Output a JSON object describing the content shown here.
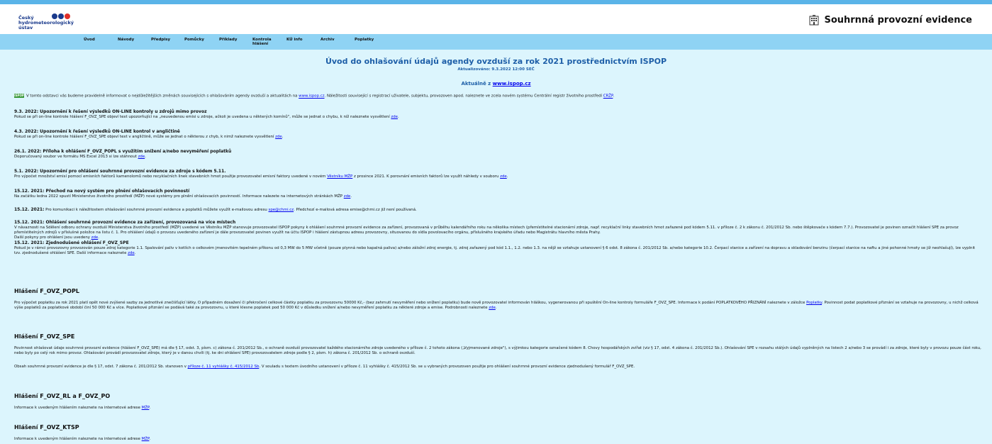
{
  "header": {
    "logo_lines": [
      "Český",
      "hydrometeorologický",
      "ústav"
    ],
    "title": "Souhrnná provozní evidence",
    "icon": "office-building-icon"
  },
  "nav": [
    "Úvod",
    "Návody",
    "Předpisy",
    "Pomůcky",
    "Příklady",
    "Kontrola hlášení",
    "KÚ info",
    "Archiv",
    "Poplatky"
  ],
  "main": {
    "title": "Úvod do ohlašování údajů agendy ovzduší za rok 2021 prostřednictvím ISPOP",
    "updated": "Aktualizováno: 9.3.2022 12:00 SEČ",
    "latest_prefix": "Aktuálně z ",
    "latest_link": "www.ispop.cz"
  },
  "intro": {
    "badge": "ISPOP",
    "text1": "V tomto odstavci vás budeme pravidelně informovat o nejdůležitějších změnách souvisejících s ohlašováním agendy ovzduší a aktualitách na ",
    "link1": "www.ispop.cz",
    "text2": ". Náležitosti související s registrací uživatele, subjektu, provozoven apod. naleznete ve zcela novém systému Centrální registr životního prostředí ",
    "link2": "CRŽP",
    "text3": "."
  },
  "news": [
    {
      "title": "9.3. 2022: Upozornění k řešení výsledků ON-LINE kontroly u zdrojů mimo provoz",
      "body": "Pokud se při on-line kontrole hlášení F_OVZ_SPE objeví text upozorňující na „neuvedenou emisi u zdroje, ačkoli je uvedena u některých komínů\", může se jednat o chybu, k níž naleznete vysvětlení ",
      "link": "zde",
      "tail": "."
    },
    {
      "title": "4.3. 2022: Upozornění k řešení výsledků ON-LINE kontrol v angličtině",
      "body": "Pokud se při on-line kontrole hlášení F_OVZ_SPE objeví text v angličtině, může se jednat o některou z chyb, k nimž naleznete vysvětlení ",
      "link": "zde",
      "tail": "."
    },
    {
      "title": "26.1. 2022: Příloha k ohlášení F_OVZ_POPL s využitím snížení a/nebo nevyměření poplatků",
      "body": "Doporučovaný soubor ve formátu MS Excel 2013 si lze stáhnout ",
      "link": "zde",
      "tail": "."
    },
    {
      "title": "5.1. 2022: Upozornění pro ohlášení souhrnné provozní evidence za zdroje s kódem 5.11.",
      "body": "Pro výpočet množství emisí pomocí emisních faktorů kamenolomů nebo recyklačních linek stavebních hmot použije provozovatel emisní faktory uvedené v novém ",
      "link": "Věstníku MŽP",
      "tail": " z prosince 2021. K porovnání emisních faktorů lze využít náhledy v souboru ",
      "link2": "zde",
      "tail2": "."
    },
    {
      "title": "15.12. 2021: Přechod na nový systém pro plnění ohlašovacích povinností",
      "body": "Na začátku ledna 2022 spustí Ministerstvo životního prostředí (MŽP) nové systémy pro plnění ohlašovacích povinností. Informace nalezete na internetových stránkách MŽP ",
      "link": "zde",
      "tail": "."
    }
  ],
  "email_note": {
    "date": "15.12. 2021:",
    "text": " Pro komunikaci k náležitostem ohlašování souhrnné provozní evidence a poplatků můžete využít e-mailovou adresu ",
    "link": "spe@chmi.cz",
    "tail": ". Předchozí e-mailová adresa emise@chmi.cz již není používaná."
  },
  "multi": {
    "title": "15.12. 2021: Ohlášení souhrnné provozní evidence za zařízení, provozovaná na více místech",
    "body": "V návaznosti na Sdělení odboru ochrany ovzduší Ministerstva životního prostředí (MŽP) uvedené ve Věstníku MŽP stanovuje provozovatel ISPOP pokyny k ohlášení souhrnné provozní evidence za zařízení, provozovaná v průběhu kalendářního roku na několika místech (přemístitelné stacionární zdroje, např. recyklační linky stavebních hmot zařazené pod kódem 5.11. v příloze č. 2 k zákonu č. 201/2012 Sb. nebo štěpkovače s kódem 7.7.). Provozovatel je povinen označit hlášení SPE za provoz přemístitelných zdrojů v příslušné položce na listu č. 1. Pro ohlášení údajů o provozu uvedeného zařízení je dále provozovatel povinen využít na účtu ISPOP i hlášení zástupnou adresu provozovny, situovanou do sídla povolovacího orgánu, příslušného krajského úřadu nebo Magistrátu hlavního města Prahy.",
    "more": "Další pokyny pro ohlášení jsou uvedeny ",
    "link": "zde",
    "tail": "."
  },
  "simple": {
    "title": "15.12. 2021: Zjednodušené ohlášení F_OVZ_SPE",
    "body": "Pokud je v rámci provozovny provozován pouze zdroj kategorie 1.1. Spalování paliv v kotlích o celkovém jmenovitém tepelném příkonu od 0,3 MW do 5 MW včetně (pouze plynná nebo kapalná paliva) a/nebo záložní zdroj energie, tj. zdroj zařazený pod kód 1.1., 1.2. nebo 1.3. na nějž se vztahuje ustanovení § 6 odst. 8 zákona č. 201/2012 Sb. a/nebo kategorie 10.2. Čerpací stanice a zařízení na dopravu a skladování benzinu (čerpací stanice na naftu a jiné pohonné hmoty se již neohlašují), lze vyplnit tzv. zjednodušené ohlášení SPE. Další informace naleznete ",
    "link": "zde",
    "tail": "."
  },
  "popl": {
    "heading": "Hlášení F_OVZ_POPL",
    "body": "Pro výpočet poplatku za rok 2021 platí opět nové zvýšené sazby za jednotlivé znečišťující látky. O případném dosažení či překročení celkové částky poplatku za provozovnu 50000 Kč,- (bez zahrnutí nevyměření nebo snížení poplatku) bude nově provozovatel informován hláškou, vygenerovanou při spuštění On-line kontroly formuláře F_OVZ_SPE. Informace k podání POPLATKOVÉHO PŘIZNÁNÍ naleznete v záložce ",
    "link": "Poplatky",
    "tail": ". Povinnost podat poplatkové přiznání se vztahuje na provozovny, u nichž celková výše poplatků za poplatkové období činí 50 000 Kč a více. Poplatkové přiznání se podává také za provozovnu, u které klesne poplatek pod 50 000 Kč v důsledku snížení a/nebo nevyměření poplatku za některé zdroje a emise. Podrobnosti naleznete ",
    "link2": "zde",
    "tail2": "."
  },
  "spe": {
    "heading": "Hlášení F_OVZ_SPE",
    "body": "Povinnost ohlašovat údaje souhrnné provozní evidence (hlášení F_OVZ_SPE) má dle § 17, odst. 3, písm. c) zákona č. 201/2012 Sb., o ochraně ovzduší provozovatel každého stacionárního zdroje uvedeného v příloze č. 2 tohoto zákona („Vyjmenované zdroje\"), s výjimkou kategorie označené kódem 8. Chovy hospodářských zvířat (viz § 17, odst. 4 zákona č. 201/2012 Sb.). Ohlašování SPE v rozsahu stálých údajů vyplněných na listech 2 a/nebo 3 se provádí i za zdroje, které byly v provozu pouze část roku, nebo byly po celý rok mimo provoz. Ohlašování provádí provozovatel zdroje, který je v danou chvíli (tj. ke dni ohlášení SPE) provozovatelem zdroje podle § 2, písm. h) zákona č. 201/2012 Sb. o ochraně ovzduší.",
    "body2": "Obsah souhrnné provozní evidence je dle § 17, odst. 7 zákona č. 201/2012 Sb. stanoven v ",
    "link": "příloze č. 11 vyhlášky č. 415/2012 Sb",
    "tail": ". V souladu s textem úvodního ustanovení v příloze č. 11 vyhlášky č. 415/2012 Sb. se u vybraných provozoven použije pro ohlášení souhrnné provozní evidence zjednodušený formulář F_OVZ_SPE."
  },
  "rl": {
    "heading": "Hlášení F_OVZ_RL a F_OVZ_PO",
    "body": "Informace k uvedeným hlášením naleznete na internetové adrese ",
    "link": "MŽP",
    "tail": "."
  },
  "ktsp": {
    "heading": "Hlášení F_OVZ_KTSP",
    "body": "Informace k uvedeným hlášením naleznete na internetové adrese ",
    "link": "MŽP",
    "tail": "."
  }
}
